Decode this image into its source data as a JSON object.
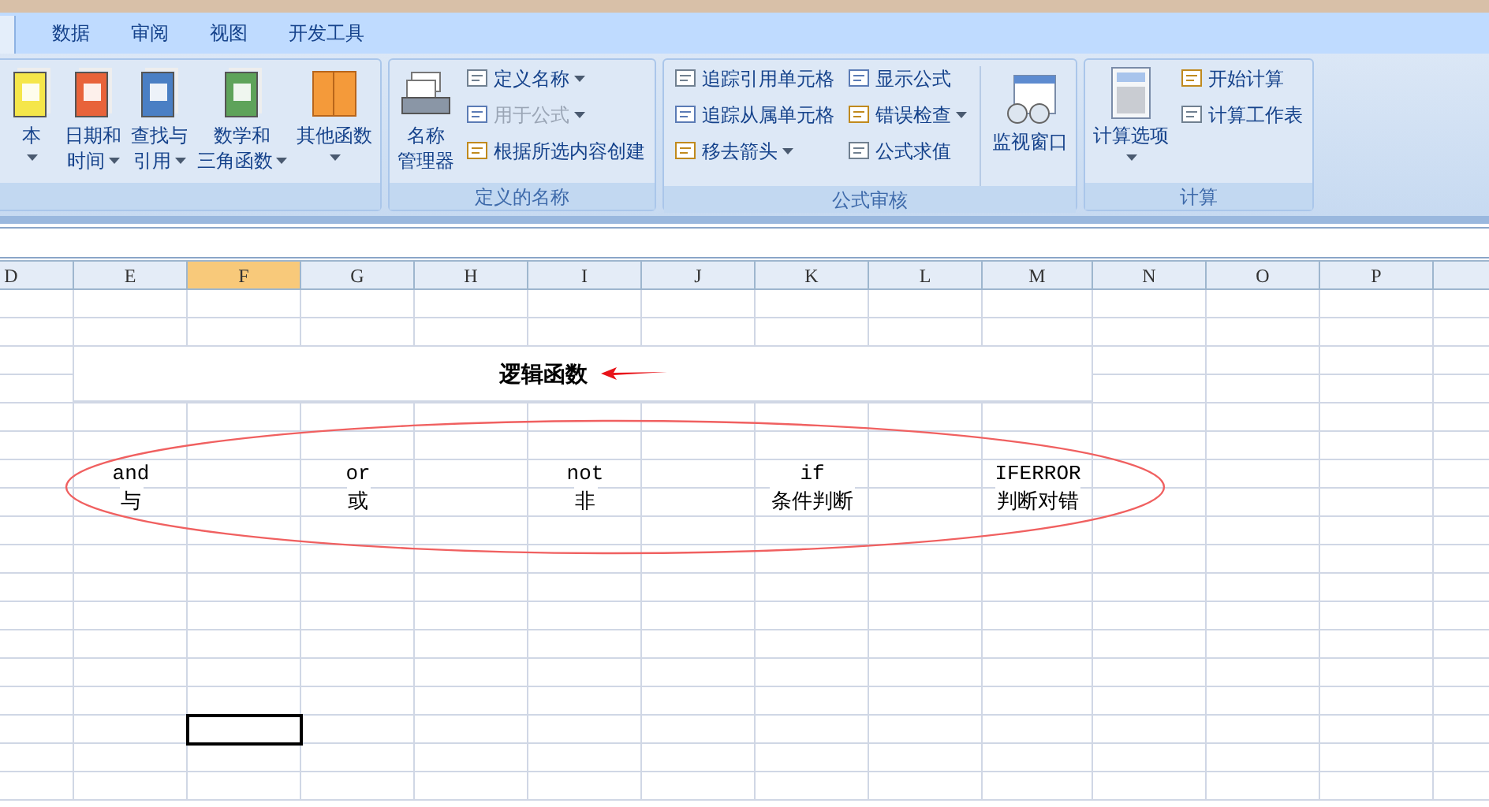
{
  "tabs": [
    {
      "label": "数据",
      "selected": false
    },
    {
      "label": "审阅",
      "selected": false
    },
    {
      "label": "视图",
      "selected": false
    },
    {
      "label": "开发工具",
      "selected": false
    }
  ],
  "groups": [
    {
      "columns": [
        [
          {
            "kind": "large",
            "lines": [
              "本"
            ],
            "dropdown": true,
            "disabled": false
          }
        ],
        [
          {
            "kind": "large",
            "lines": [
              "日期和",
              "时间"
            ],
            "dropdown": true,
            "disabled": false
          }
        ],
        [
          {
            "kind": "large",
            "lines": [
              "查找与",
              "引用"
            ],
            "dropdown": true,
            "disabled": false
          }
        ],
        [
          {
            "kind": "large",
            "lines": [
              "数学和",
              "三角函数"
            ],
            "dropdown": true,
            "disabled": false
          }
        ],
        [
          {
            "kind": "large",
            "lines": [
              "其他函数"
            ],
            "dropdown": true,
            "disabled": false
          }
        ]
      ]
    },
    {
      "label": "定义的名称",
      "columns": [
        [
          {
            "kind": "large",
            "lines": [
              "名称",
              "管理器"
            ],
            "dropdown": false,
            "disabled": false
          }
        ],
        [
          {
            "kind": "small",
            "lines": [
              "定义名称"
            ],
            "dropdown": true,
            "disabled": false
          },
          {
            "kind": "small",
            "lines": [
              "用于公式"
            ],
            "dropdown": true,
            "disabled": true
          },
          {
            "kind": "small",
            "lines": [
              "根据所选内容创建"
            ],
            "dropdown": false,
            "disabled": false
          }
        ]
      ]
    },
    {
      "label": "公式审核",
      "columns": [
        [
          {
            "kind": "small",
            "lines": [
              "追踪引用单元格"
            ],
            "dropdown": false,
            "disabled": false
          },
          {
            "kind": "small",
            "lines": [
              "追踪从属单元格"
            ],
            "dropdown": false,
            "disabled": false
          },
          {
            "kind": "small",
            "lines": [
              "移去箭头"
            ],
            "dropdown": true,
            "disabled": false
          }
        ],
        [
          {
            "kind": "small",
            "lines": [
              "显示公式"
            ],
            "dropdown": false,
            "disabled": false
          },
          {
            "kind": "small",
            "lines": [
              "错误检查"
            ],
            "dropdown": true,
            "disabled": false
          },
          {
            "kind": "small",
            "lines": [
              "公式求值"
            ],
            "dropdown": false,
            "disabled": false
          }
        ],
        [
          {
            "kind": "large",
            "lines": [
              "监视窗口"
            ],
            "dropdown": false,
            "disabled": false
          }
        ]
      ]
    },
    {
      "label": "计算",
      "columns": [
        [
          {
            "kind": "large",
            "lines": [
              "计算选项"
            ],
            "dropdown": true,
            "disabled": false
          }
        ],
        [
          {
            "kind": "small",
            "lines": [
              "开始计算"
            ],
            "dropdown": false,
            "disabled": false
          },
          {
            "kind": "small",
            "lines": [
              "计算工作表"
            ],
            "dropdown": false,
            "disabled": false
          }
        ]
      ]
    }
  ],
  "sheet": {
    "columns": [
      {
        "label": "D",
        "selected": false
      },
      {
        "label": "E",
        "selected": false
      },
      {
        "label": "F",
        "selected": true
      },
      {
        "label": "G",
        "selected": false
      },
      {
        "label": "H",
        "selected": false
      },
      {
        "label": "I",
        "selected": false
      },
      {
        "label": "J",
        "selected": false
      },
      {
        "label": "K",
        "selected": false
      },
      {
        "label": "L",
        "selected": false
      },
      {
        "label": "M",
        "selected": false
      },
      {
        "label": "N",
        "selected": false
      },
      {
        "label": "O",
        "selected": false
      },
      {
        "label": "P",
        "selected": false
      }
    ],
    "title": "逻辑函数",
    "functions": [
      {
        "name": "and",
        "meaning": "与"
      },
      {
        "name": "or",
        "meaning": "或"
      },
      {
        "name": "not",
        "meaning": "非"
      },
      {
        "name": "if",
        "meaning": "条件判断"
      },
      {
        "name": "IFERROR",
        "meaning": "判断对错"
      }
    ]
  }
}
